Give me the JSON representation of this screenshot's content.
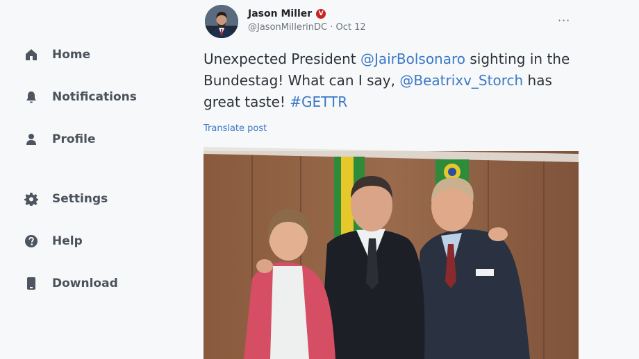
{
  "sidebar": {
    "items": [
      {
        "label": "Home",
        "icon": "home-icon"
      },
      {
        "label": "Notifications",
        "icon": "bell-icon"
      },
      {
        "label": "Profile",
        "icon": "user-icon"
      },
      {
        "label": "Settings",
        "icon": "gear-icon"
      },
      {
        "label": "Help",
        "icon": "help-icon"
      },
      {
        "label": "Download",
        "icon": "phone-icon"
      }
    ]
  },
  "post": {
    "author_name": "Jason Miller",
    "verified_badge": "V",
    "handle": "@JasonMillerinDC",
    "separator": "·",
    "date": "Oct 12",
    "more_label": "···",
    "text": {
      "part1": "Unexpected President ",
      "mention1": "@JairBolsonaro",
      "part2": " sighting in the Bundestag! What can I say, ",
      "mention2": "@Beatrixv_Storch",
      "part3": " has great taste! ",
      "hashtag": "#GETTR"
    },
    "translate_label": "Translate post"
  },
  "colors": {
    "background": "#f7f8f9",
    "link": "#3a78c9",
    "verified": "#c8231f",
    "nav_text": "#4a525c"
  }
}
